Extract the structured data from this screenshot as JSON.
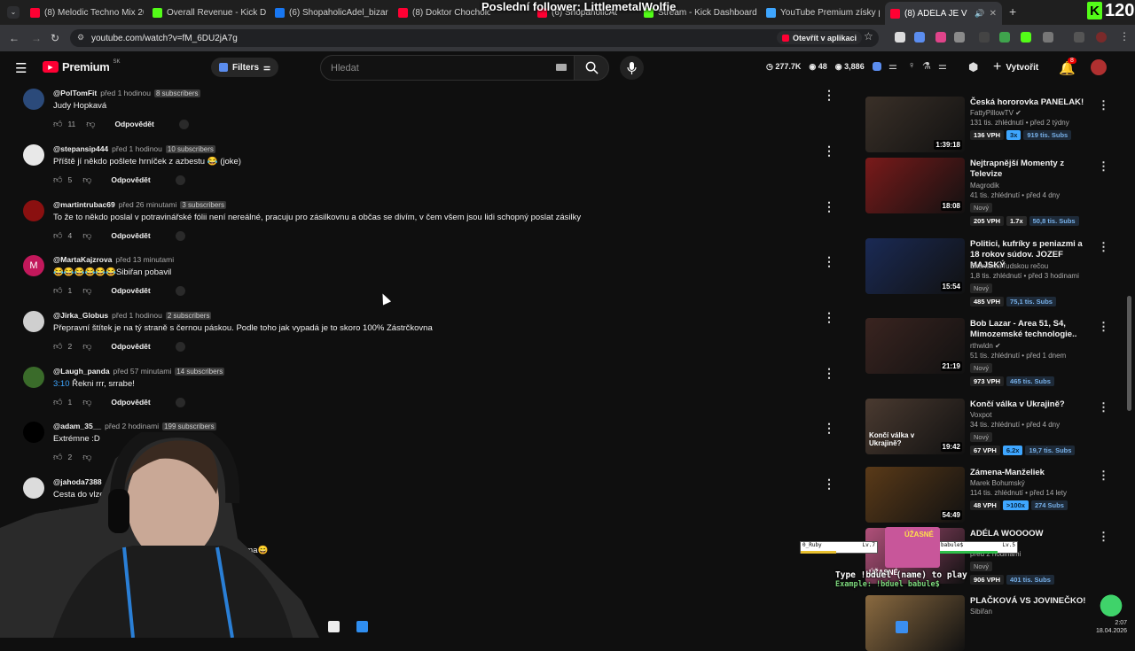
{
  "browser": {
    "tabs": [
      {
        "label": "(8) Melodic Techno Mix 20",
        "favicon_color": "#ff0033"
      },
      {
        "label": "Overall Revenue - Kick Da",
        "favicon_color": "#53fc18"
      },
      {
        "label": "(6) ShopaholicAdel_bizar",
        "favicon_color": "#1877f2"
      },
      {
        "label": "(8) Doktor Chocholouse",
        "favicon_color": "#ff0033"
      },
      {
        "label": "(6) ShopaholicAdel",
        "favicon_color": "#ff0033"
      },
      {
        "label": "Stream - Kick Dashboard",
        "favicon_color": "#53fc18"
      },
      {
        "label": "YouTube Premium získy p",
        "favicon_color": "#3ea6ff"
      },
      {
        "label": "(8) ADÉLA JE V PRŮŠVIHU",
        "favicon_color": "#ff0033"
      }
    ],
    "url": "youtube.com/watch?v=fM_6DU2jA7g",
    "open_in_app_label": "Otevřít v aplikaci"
  },
  "youtube_header": {
    "logo_label": "Premium",
    "logo_region": "SK",
    "filters_label": "Filters",
    "search_placeholder": "Hledat",
    "stats": [
      "277.7K",
      "48",
      "3,886"
    ],
    "create_label": "Vytvořit",
    "notification_count": "8"
  },
  "comments": [
    {
      "user": "@PolTomFit",
      "time": "před 1 hodinou",
      "subs": "8 subscribers",
      "text": "Judy Hopkavá",
      "likes": "11",
      "reply": "Odpovědět",
      "avatar_color": "#2b4a7a"
    },
    {
      "user": "@stepansip444",
      "time": "před 1 hodinou",
      "subs": "10 subscribers",
      "text": "Příště jí někdo pošlete hrníček z azbestu 😂 (joke)",
      "likes": "5",
      "reply": "Odpovědět",
      "avatar_color": "#e8e8e8"
    },
    {
      "user": "@martintrubac69",
      "time": "před 26 minutami",
      "subs": "3 subscribers",
      "text": "To že to někdo poslal v potravinářské fólii není nereálné, pracuju pro zásilkovnu a občas se divím, v čem všem jsou lidi schopný poslat zásilky",
      "likes": "4",
      "reply": "Odpovědět",
      "avatar_color": "#8a1010"
    },
    {
      "user": "@MartaKajzrova",
      "time": "před 13 minutami",
      "subs": "",
      "text": "😂😂😂😂😂😂Sibiřan pobavil",
      "likes": "1",
      "reply": "Odpovědět",
      "avatar_color": "#c2185b",
      "avatar_letter": "M"
    },
    {
      "user": "@Jirka_Globus",
      "time": "před 1 hodinou",
      "subs": "2 subscribers",
      "text": "Přepravní štítek je na tý straně s černou páskou. Podle toho jak vypadá je to skoro 100% Zástrčkovna",
      "likes": "2",
      "reply": "Odpovědět",
      "avatar_color": "#cfcfcf"
    },
    {
      "user": "@Laugh_panda",
      "time": "před 57 minutami",
      "subs": "14 subscribers",
      "text": "Řekni rrr, srrabe!",
      "timestamp_link": "3:10",
      "likes": "1",
      "reply": "Odpovědět",
      "avatar_color": "#3a6b2a"
    },
    {
      "user": "@adam_35__",
      "time": "před 2 hodinami",
      "subs": "199 subscribers",
      "text": "Extrémne :D",
      "likes": "2",
      "reply": "",
      "avatar_color": "#000000"
    },
    {
      "user": "@jahoda7388",
      "time": "",
      "subs": "",
      "text": "Cesta do vlze",
      "likes": "",
      "reply": "",
      "avatar_color": "#dcdcdc"
    }
  ],
  "partial_comment_text": "ama😄",
  "sidebar": [
    {
      "title": "Česká hororovka PANELAK!",
      "channel": "FattyPillowTV",
      "verified": true,
      "meta": "131 tis. zhlédnutí • před 2 týdny",
      "duration": "1:39:18",
      "new": "",
      "vph": "136 VPH",
      "mult": "3x",
      "mult_hi": true,
      "subs": "919 tis. Subs",
      "thumb": "#3a3028"
    },
    {
      "title": "Nejtrapnější Momenty z Televize",
      "channel": "Magrodik",
      "verified": false,
      "meta": "41 tis. zhlédnutí • před 4 dny",
      "duration": "18:08",
      "new": "Nový",
      "vph": "205 VPH",
      "mult": "1.7x",
      "mult_hi": false,
      "subs": "50,8 tis. Subs",
      "thumb": "#7a1a1a"
    },
    {
      "title": "Politici, kufríky s peniazmi a 18 rokov súdov. JOZEF MAJSKÝ",
      "channel": "Ekonómia ľudskou rečou",
      "verified": false,
      "meta": "1,8 tis. zhlédnutí • před 3 hodinami",
      "duration": "15:54",
      "new": "Nový",
      "vph": "485 VPH",
      "mult": "",
      "mult_hi": false,
      "subs": "75,1 tis. Subs",
      "thumb": "#1a2a55"
    },
    {
      "title": "Bob Lazar - Area 51, S4, Mimozemské technologie..",
      "channel": "rthwldn",
      "verified": true,
      "meta": "51 tis. zhlédnutí • před 1 dnem",
      "duration": "21:19",
      "new": "Nový",
      "vph": "973 VPH",
      "mult": "",
      "mult_hi": false,
      "subs": "465 tis. Subs",
      "thumb": "#3a2420"
    },
    {
      "title": "Končí válka v Ukrajině?",
      "channel": "Voxpot",
      "verified": false,
      "meta": "34 tis. zhlédnutí • před 4 dny",
      "duration": "19:42",
      "new": "Nový",
      "vph": "67 VPH",
      "mult": "6.2x",
      "mult_hi": true,
      "subs": "19,7 tis. Subs",
      "thumb": "#4a3a30",
      "thumb_text": "Končí válka v Ukrajině?"
    },
    {
      "title": "Zámena-Manželiek",
      "channel": "Marek Bohumský",
      "verified": false,
      "meta": "114 tis. zhlédnutí • před 14 lety",
      "duration": "54:49",
      "new": "",
      "vph": "48 VPH",
      "mult": ">100x",
      "mult_hi": true,
      "subs": "274 Subs",
      "thumb": "#5a3a18"
    },
    {
      "title": "ADÉLA WOOOOW",
      "channel": "",
      "verified": false,
      "meta": "před 2 hodinami",
      "duration": "",
      "new": "Nový",
      "vph": "906 VPH",
      "mult": "",
      "mult_hi": false,
      "subs": "401 tis. Subs",
      "thumb": "#b0507a",
      "thumb_text": "ÚŽASNÉ"
    },
    {
      "title": "PLAČKOVÁ VS JOVINEČKO!",
      "channel": "Sibiřan",
      "verified": false,
      "meta": "",
      "duration": "",
      "new": "",
      "vph": "",
      "mult": "",
      "mult_hi": false,
      "subs": "",
      "thumb": "#8a6a40"
    }
  ],
  "overlay": {
    "last_follower": "Poslední follower: LittlemetalWolfie",
    "kick_count": "120",
    "game_player1": "0_Ruby",
    "game_player2": "babule$",
    "game_level1": "Lv.7",
    "game_level2": "Lv.5",
    "duel_line1": "Type !bduel (name) to play",
    "duel_line2": "Example: !bduel babule$",
    "clock_time": "2:07",
    "clock_date": "18.04.2026"
  }
}
